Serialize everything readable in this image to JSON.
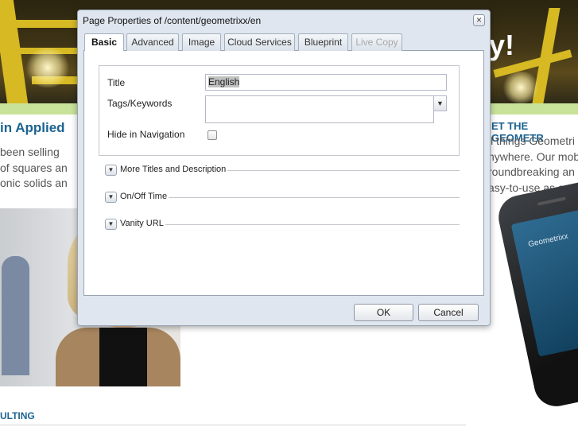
{
  "background": {
    "banner_text": "y!",
    "heading_left": "in Applied",
    "body_left": [
      "been selling",
      "of squares an",
      "onic solids an"
    ],
    "heading_right": "ET THE GEOMETR",
    "body_right": [
      "ll things Geometri",
      "nywhere. Our mob",
      "roundbreaking an",
      "asy-to-use as our"
    ],
    "phone_brand": "Geometrixx",
    "bottom_heading": "ULTING"
  },
  "dialog": {
    "title": "Page Properties of /content/geometrixx/en",
    "close_glyph": "×",
    "tabs": [
      {
        "label": "Basic",
        "state": "active"
      },
      {
        "label": "Advanced",
        "state": "normal"
      },
      {
        "label": "Image",
        "state": "normal"
      },
      {
        "label": "Cloud Services",
        "state": "normal"
      },
      {
        "label": "Blueprint",
        "state": "normal"
      },
      {
        "label": "Live Copy",
        "state": "disabled"
      }
    ],
    "fields": {
      "title_label": "Title",
      "title_value": "English",
      "tags_label": "Tags/Keywords",
      "tags_value": "",
      "hide_label": "Hide in Navigation",
      "hide_checked": false
    },
    "sections": [
      {
        "label": "More Titles and Description"
      },
      {
        "label": "On/Off Time"
      },
      {
        "label": "Vanity URL"
      }
    ],
    "toggle_glyph": "▼",
    "dropdown_glyph": "▼",
    "buttons": {
      "ok": "OK",
      "cancel": "Cancel"
    }
  },
  "colors": {
    "link_heading": "#1c6391",
    "dialog_bg": "#dfe6ef",
    "highlight_strip": "#c8e29a"
  }
}
